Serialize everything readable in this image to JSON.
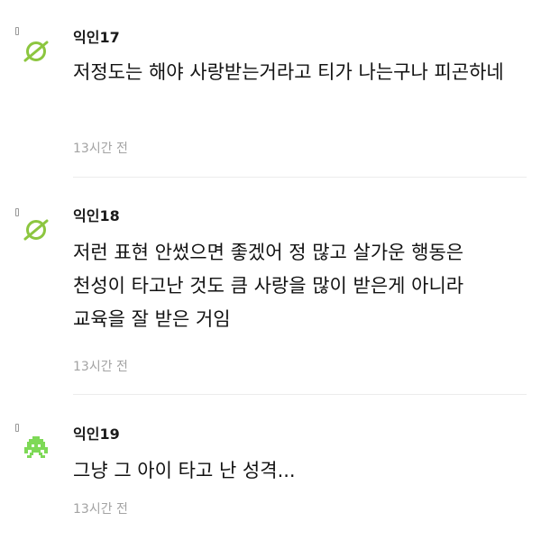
{
  "comments": [
    {
      "author": "익인17",
      "avatar_icon": "saturn-planet-icon",
      "avatar_color": "#8cc63f",
      "text": "저정도는 해야 사랑받는거라고 티가 나는구나 피곤하네",
      "time": "13시간 전"
    },
    {
      "author": "익인18",
      "avatar_icon": "saturn-planet-icon",
      "avatar_color": "#8cc63f",
      "text": "저런 표현 안썼으면 좋겠어 정 많고 살가운 행동은 천성이 타고난 것도 큼 사랑을 많이 받은게 아니라 교육을 잘 받은 거임",
      "time": "13시간 전"
    },
    {
      "author": "익인19",
      "avatar_icon": "space-invader-icon",
      "avatar_color": "#7ed957",
      "text": "그냥 그 아이 타고 난 성격...",
      "time": "13시간 전"
    }
  ]
}
